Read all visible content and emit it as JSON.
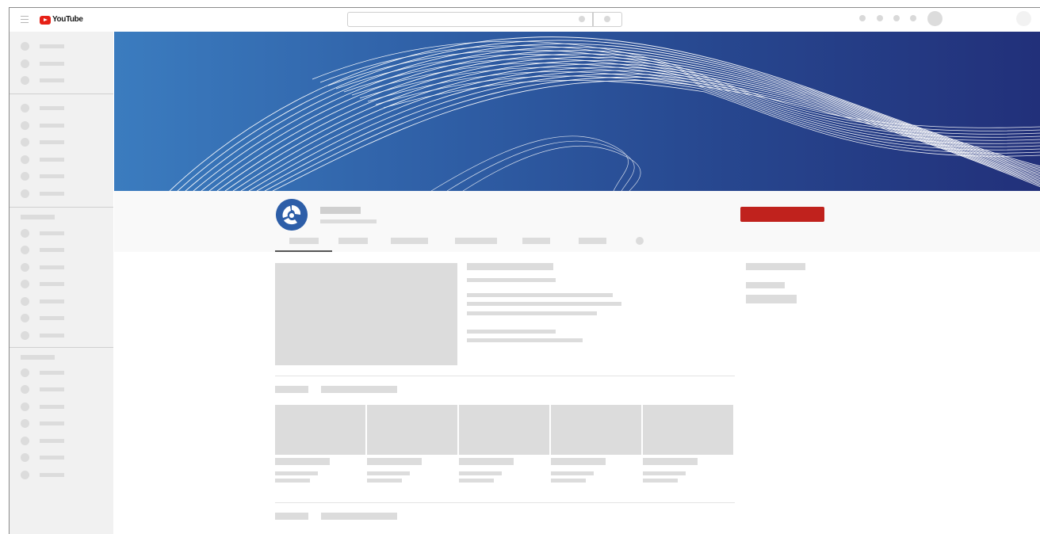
{
  "app": {
    "logo_text": "YouTube",
    "brand_color": "#e62117"
  },
  "topbar": {
    "icons": [
      "menu-icon",
      "youtube-logo",
      "keyboard-icon",
      "search-icon",
      "create-icon",
      "apps-icon",
      "messages-icon",
      "notifications-icon",
      "account-avatar",
      "extra-avatar"
    ]
  },
  "colors": {
    "subscribe_button": "#c0221d",
    "banner_left": "#3b7cbf",
    "banner_right": "#22307a",
    "placeholder": "#dcdcdc"
  },
  "channel": {
    "logo_icon": "rosatom-logo"
  }
}
